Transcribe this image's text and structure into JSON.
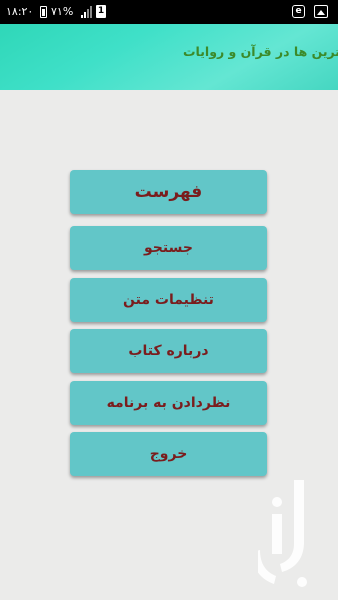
{
  "status_bar": {
    "time": "۱۸:۲۰",
    "battery_percent": "۷۱%",
    "sim_label": "1",
    "app_icon_letter": "e"
  },
  "header": {
    "title": "ترین ها در قرآن و روایات"
  },
  "menu": {
    "items": [
      {
        "label": "فهرست"
      },
      {
        "label": "جستجو"
      },
      {
        "label": "تنظیمات متن"
      },
      {
        "label": "درباره کتاب"
      },
      {
        "label": "نظردادن به برنامه"
      },
      {
        "label": "خروج"
      }
    ]
  },
  "colors": {
    "header_gradient_start": "#2fd7b8",
    "header_gradient_end": "#64e6d3",
    "header_title": "#3c8a2a",
    "button_bg": "#62c6c8",
    "button_text": "#7a1d1d",
    "page_bg": "#ebebea"
  }
}
